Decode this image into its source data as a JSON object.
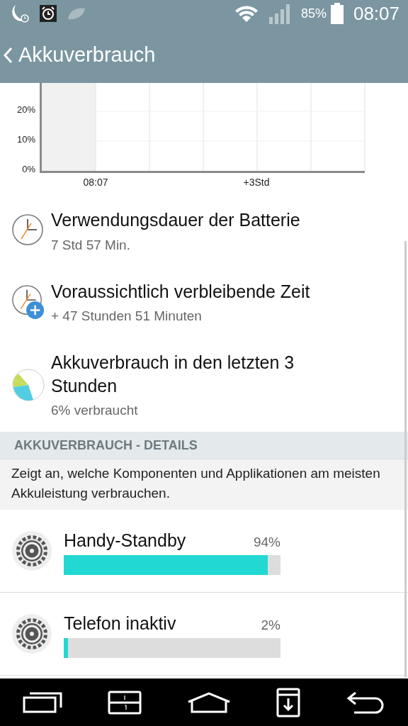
{
  "status_bar": {
    "battery": "85%",
    "time": "08:07"
  },
  "app_bar": {
    "title": "Akkuverbrauch"
  },
  "chart": {
    "y_labels": [
      "20%",
      "10%",
      "0%"
    ],
    "x_labels": [
      "08:07",
      "+3Std"
    ]
  },
  "items": [
    {
      "kind": "clock",
      "title": "Verwendungsdauer der Batterie",
      "subtitle": "7 Std 57 Min."
    },
    {
      "kind": "clock-plus",
      "title": "Voraussichtlich verbleibende Zeit",
      "subtitle": "+ 47 Stunden 51 Minuten"
    },
    {
      "kind": "pie",
      "title": "Akkuverbrauch in den letzten 3 Stunden",
      "subtitle": "6% verbraucht"
    }
  ],
  "details": {
    "header": "AKKUVERBRAUCH - DETAILS",
    "description": "Zeigt an, welche Komponenten und Applikationen am meisten Akkuleistung verbrauchen."
  },
  "usage": [
    {
      "name": "Handy-Standby",
      "percent": "94%",
      "level": 0.94
    },
    {
      "name": "Telefon inaktiv",
      "percent": "2%",
      "level": 0.02
    }
  ]
}
